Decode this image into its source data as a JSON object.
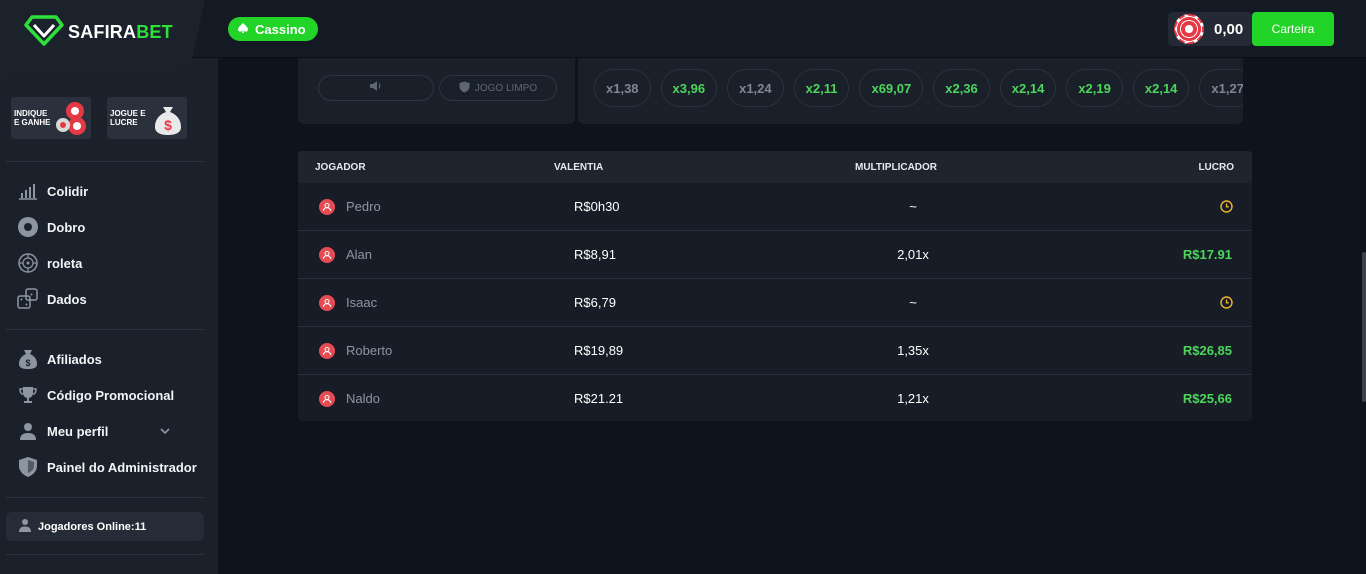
{
  "header": {
    "logo_main": "SAFIRA",
    "logo_accent": "BET",
    "cassino_label": "Cassino",
    "balance": "0,00",
    "wallet_label": "Carteira"
  },
  "sidebar": {
    "promos": [
      {
        "text": "INDIQUE E GANHE"
      },
      {
        "text": "JOGUE E LUCRE"
      }
    ],
    "games": [
      {
        "label": "Colidir",
        "icon": "chart-bars-icon"
      },
      {
        "label": "Dobro",
        "icon": "disc-icon"
      },
      {
        "label": "roleta",
        "icon": "roulette-icon"
      },
      {
        "label": "Dados",
        "icon": "dice-icon"
      }
    ],
    "menu": [
      {
        "label": "Afiliados",
        "icon": "money-bag-icon"
      },
      {
        "label": "Código Promocional",
        "icon": "trophy-icon"
      },
      {
        "label": "Meu perfil",
        "icon": "user-icon"
      },
      {
        "label": "Painel do Administrador",
        "icon": "shield-icon"
      }
    ],
    "online_label": "Jogadores Online:11"
  },
  "game_panel": {
    "fair_label": "JOGO LIMPO",
    "multipliers": [
      {
        "value": "x1,38",
        "color": "gray"
      },
      {
        "value": "x3,96",
        "color": "green"
      },
      {
        "value": "x1,24",
        "color": "gray"
      },
      {
        "value": "x2,11",
        "color": "green"
      },
      {
        "value": "x69,07",
        "color": "green"
      },
      {
        "value": "x2,36",
        "color": "green"
      },
      {
        "value": "x2,14",
        "color": "green"
      },
      {
        "value": "x2,19",
        "color": "green"
      },
      {
        "value": "x2,14",
        "color": "green"
      },
      {
        "value": "x1,27",
        "color": "gray"
      }
    ]
  },
  "table": {
    "headers": {
      "player": "JOGADOR",
      "bet": "VALENTIA",
      "multiplier": "MULTIPLICADOR",
      "profit": "LUCRO"
    },
    "rows": [
      {
        "name": "Pedro",
        "bet": "R$0h30",
        "multiplier": "~",
        "profit": "",
        "pending": true
      },
      {
        "name": "Alan",
        "bet": "R$8,91",
        "multiplier": "2,01x",
        "profit": "R$17.91",
        "pending": false
      },
      {
        "name": "Isaac",
        "bet": "R$6,79",
        "multiplier": "~",
        "profit": "",
        "pending": true
      },
      {
        "name": "Roberto",
        "bet": "R$19,89",
        "multiplier": "1,35x",
        "profit": "R$26,85",
        "pending": false
      },
      {
        "name": "Naldo",
        "bet": "R$21.21",
        "multiplier": "1,21x",
        "profit": "R$25,66",
        "pending": false
      }
    ]
  },
  "colors": {
    "accent_green": "#22d428",
    "profit_green": "#4cd65b",
    "pending_yellow": "#f0b429",
    "avatar_red": "#e74b56"
  }
}
